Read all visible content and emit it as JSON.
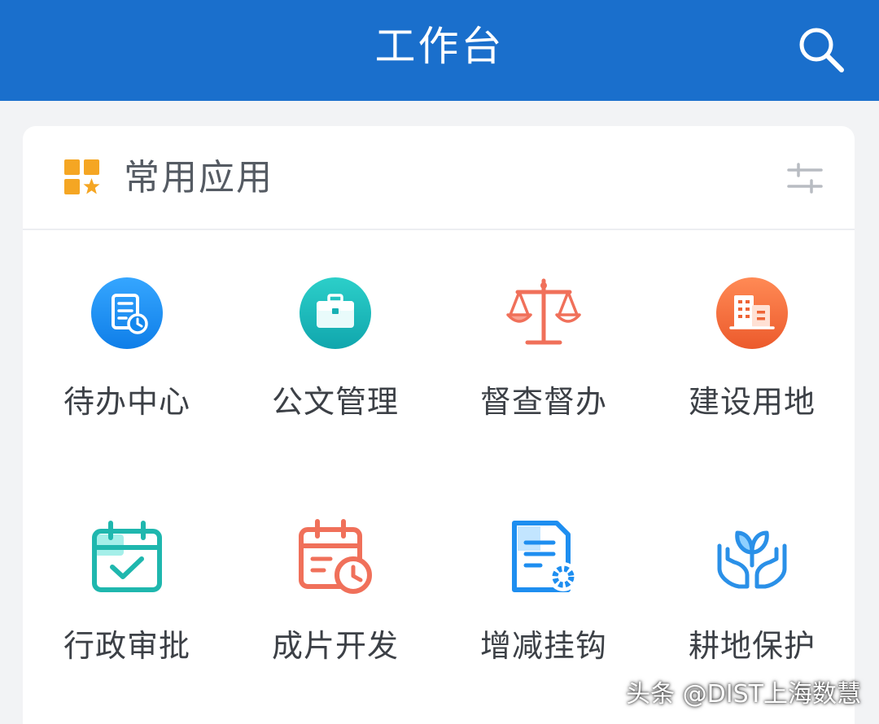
{
  "header": {
    "title": "工作台",
    "search_icon": "search-icon",
    "background_color": "#1a6fcc"
  },
  "section": {
    "title": "常用应用",
    "icon": "apps-grid-star-icon",
    "settings_icon": "sliders-icon",
    "accent_color": "#f5a623"
  },
  "apps": [
    {
      "label": "待办中心",
      "icon": "document-clock-icon",
      "color": "#1e90f0"
    },
    {
      "label": "公文管理",
      "icon": "briefcase-icon",
      "color": "#18b6b8"
    },
    {
      "label": "督查督办",
      "icon": "balance-scale-icon",
      "color": "#f0705a"
    },
    {
      "label": "建设用地",
      "icon": "building-icon",
      "color": "#f06a3a"
    },
    {
      "label": "行政审批",
      "icon": "calendar-check-icon",
      "color": "#20b8b0"
    },
    {
      "label": "成片开发",
      "icon": "calendar-clock-icon",
      "color": "#f0705a"
    },
    {
      "label": "增减挂钩",
      "icon": "document-gear-icon",
      "color": "#1e8ef0"
    },
    {
      "label": "耕地保护",
      "icon": "hands-sprout-icon",
      "color": "#2a90e8"
    }
  ],
  "watermark": "头条 @DIST上海数慧"
}
